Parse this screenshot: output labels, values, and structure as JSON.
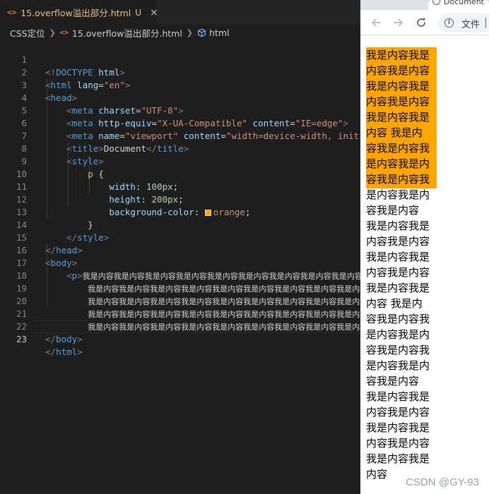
{
  "editor": {
    "tab": {
      "icon": "<>",
      "title": "15.overflow溢出部分.html",
      "badge": "U",
      "close": "×"
    },
    "breadcrumb": {
      "folder": "CSS定位",
      "file": "15.overflow溢出部分.html",
      "symbol": "html"
    },
    "line_numbers": [
      "1",
      "2",
      "3",
      "4",
      "5",
      "6",
      "7",
      "8",
      "9",
      "10",
      "11",
      "12",
      "13",
      "14",
      "15",
      "16",
      "17",
      "18",
      "19",
      "20",
      "21",
      "22",
      "23"
    ],
    "active_line": "23",
    "code": {
      "l1": {
        "lt": "<!",
        "tag": "DOCTYPE",
        "attr": "html",
        "gt": ">"
      },
      "l2": {
        "tag": "html",
        "attr": "lang",
        "val": "\"en\""
      },
      "l3": {
        "tag": "head"
      },
      "l4": {
        "tag": "meta",
        "attr": "charset",
        "val": "\"UTF-8\""
      },
      "l5": {
        "tag": "meta",
        "attr1": "http-equiv",
        "val1": "\"X-UA-Compatible\"",
        "attr2": "content",
        "val2": "\"IE=edge\""
      },
      "l6": {
        "tag": "meta",
        "attr1": "name",
        "val1": "\"viewport\"",
        "attr2": "content",
        "val2": "\"width=device-width, initial"
      },
      "l7": {
        "tag": "title",
        "text": "Document"
      },
      "l8": {
        "tag": "style"
      },
      "l9": {
        "selector": "p",
        "brace": "{"
      },
      "l10": {
        "prop": "width",
        "value": "100px"
      },
      "l11": {
        "prop": "height",
        "value": "200px"
      },
      "l12": {
        "prop": "background-color",
        "value": "orange",
        "swatch": "#ffa500"
      },
      "l13": {
        "brace": "}"
      },
      "l14": {
        "tag": "style"
      },
      "l15": {
        "tag": "head"
      },
      "l16": {
        "tag": "body"
      },
      "l17": {
        "tag": "p",
        "text": "我是内容我是内容我是内容我是内容我是内容我是内容我是内容我是内容我是内容"
      },
      "l18": {
        "text": "我是内容我是内容我是内容我是内容我是内容我是内容我是内容我是内容我是内容"
      },
      "l19": {
        "text": "我是内容我是内容我是内容我是内容我是内容我是内容我是内容我是内容我是内容"
      },
      "l20": {
        "text": "我是内容我是内容我是内容我是内容我是内容我是内容我是内容我是内容我是内容"
      },
      "l21": {
        "text": "我是内容我是内容我是内容我是内容我是内容我是内容我是内容我是内容我是内容"
      },
      "l22": {
        "tag": "body"
      },
      "l23": {
        "tag": "html"
      }
    }
  },
  "browser": {
    "tab_title": "Document",
    "address_label": "文件",
    "page_lines": [
      "我是内容我是",
      "内容我是内容",
      "我是内容我是",
      "内容我是内容",
      "我是内容我是",
      "内容 我是内",
      "容我是内容我",
      "是内容我是内",
      "容我是内容我",
      "是内容我是内",
      "容我是内容",
      "我是内容我是",
      "内容我是内容",
      "我是内容我是",
      "内容我是内容",
      "我是内容我是",
      "内容 我是内",
      "容我是内容我",
      "是内容我是内",
      "容我是内容我",
      "是内容我是内",
      "容我是内容",
      "我是内容我是",
      "内容我是内容",
      "我是内容我是",
      "内容我是内容",
      "我是内容我是",
      "内容"
    ]
  },
  "watermark": "CSDN @GY-93",
  "colors": {
    "box_background": "#ffa500",
    "editor_background": "#1e1e1e"
  }
}
